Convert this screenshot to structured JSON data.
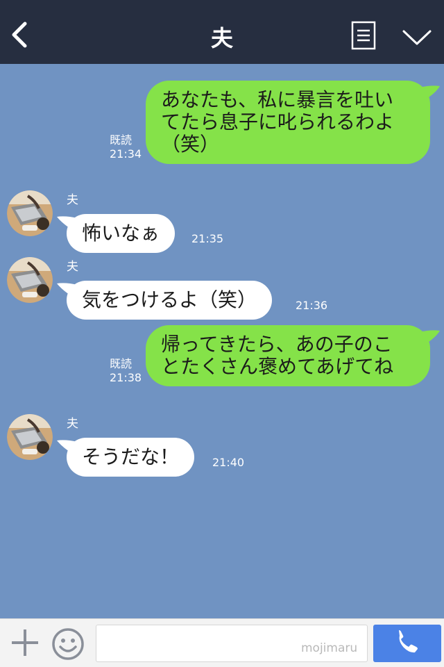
{
  "header": {
    "title": "夫",
    "bg_color": "#262e40"
  },
  "chat": {
    "bg_color": "#7093c2",
    "outgoing_bubble_color": "#85e249",
    "incoming_bubble_color": "#ffffff",
    "messages": [
      {
        "direction": "out",
        "lines": [
          "あなたも、私に暴言を吐い",
          "てたら息子に叱られるわよ",
          "（笑）"
        ],
        "read_label": "既読",
        "time": "21:34"
      },
      {
        "direction": "in",
        "sender": "夫",
        "text": "怖いなぁ",
        "time": "21:35"
      },
      {
        "direction": "in",
        "sender": "夫",
        "text": "気をつけるよ（笑）",
        "time": "21:36"
      },
      {
        "direction": "out",
        "lines": [
          "帰ってきたら、あの子のこ",
          "とたくさん褒めてあげてね"
        ],
        "read_label": "既読",
        "time": "21:38"
      },
      {
        "direction": "in",
        "sender": "夫",
        "text": "そうだな！",
        "time": "21:40"
      }
    ]
  },
  "footer": {
    "input_value": "",
    "watermark": "mojimaru",
    "call_button_color": "#4b82e6"
  },
  "icons": {
    "back": "back-chevron-icon",
    "note": "note-icon",
    "menu": "chevron-down-icon",
    "plus": "plus-icon",
    "emoji": "emoji-icon",
    "call": "phone-icon"
  }
}
